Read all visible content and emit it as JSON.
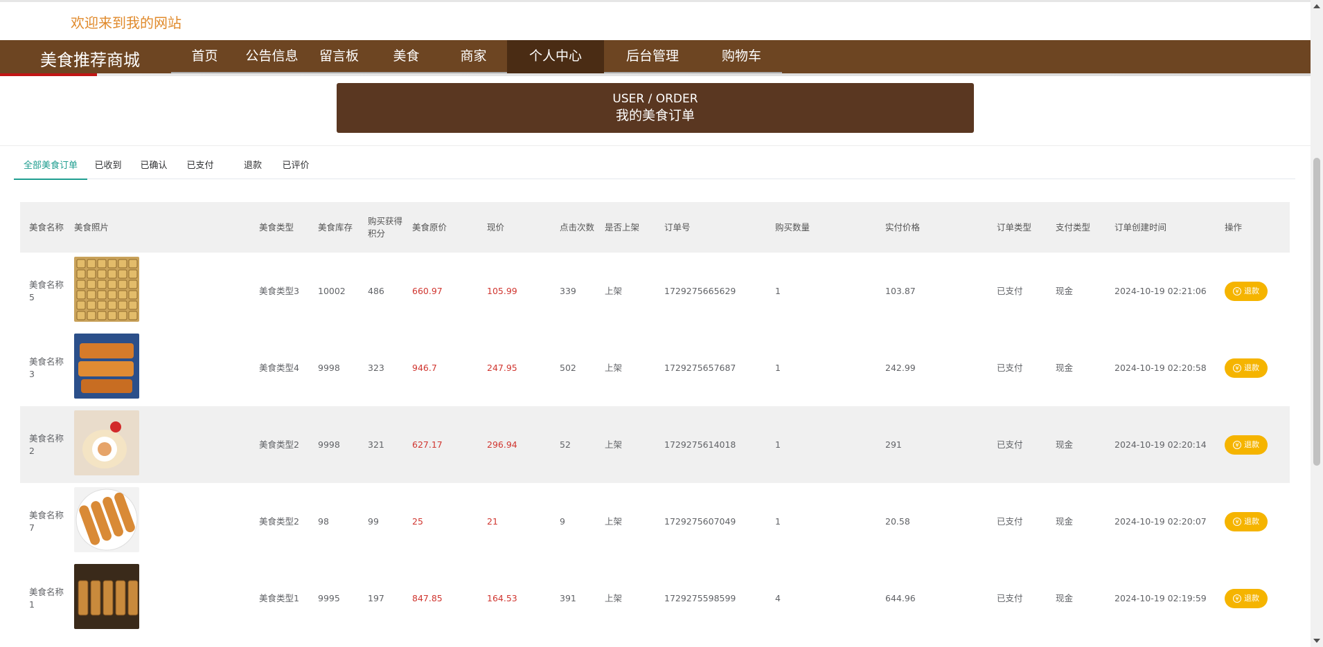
{
  "header": {
    "welcome": "欢迎来到我的网站"
  },
  "nav": {
    "brand": "美食推荐商城",
    "items": [
      {
        "label": "首页",
        "active": false
      },
      {
        "label": "公告信息",
        "active": false
      },
      {
        "label": "留言板",
        "active": false
      },
      {
        "label": "美食",
        "active": false
      },
      {
        "label": "商家",
        "active": false
      },
      {
        "label": "个人中心",
        "active": true
      },
      {
        "label": "后台管理",
        "active": false
      },
      {
        "label": "购物车",
        "active": false
      }
    ]
  },
  "banner": {
    "en": "USER / ORDER",
    "zh": "我的美食订单"
  },
  "tabs": [
    {
      "label": "全部美食订单",
      "active": true
    },
    {
      "label": "已收到",
      "active": false
    },
    {
      "label": "已确认",
      "active": false
    },
    {
      "label": "已支付",
      "active": false
    },
    {
      "label": "退款",
      "active": false
    },
    {
      "label": "已评价",
      "active": false
    }
  ],
  "table": {
    "columns": [
      "美食名称",
      "美食照片",
      "美食类型",
      "美食库存",
      "购买获得积分",
      "美食原价",
      "现价",
      "点击次数",
      "是否上架",
      "订单号",
      "购买数量",
      "实付价格",
      "订单类型",
      "支付类型",
      "订单创建时间",
      "操作"
    ],
    "rows": [
      {
        "name": "美食名称5",
        "photo": "fried-pastry-grid",
        "type": "美食类型3",
        "stock": "10002",
        "points": "486",
        "orig": "660.97",
        "price": "105.99",
        "clicks": "339",
        "shelf": "上架",
        "order_no": "1729275665629",
        "qty": "1",
        "paid": "103.87",
        "order_type": "已支付",
        "pay_type": "现金",
        "created": "2024-10-19 02:21:06",
        "action": "退款"
      },
      {
        "name": "美食名称3",
        "photo": "glazed-cake-bars",
        "type": "美食类型4",
        "stock": "9998",
        "points": "323",
        "orig": "946.7",
        "price": "247.95",
        "clicks": "502",
        "shelf": "上架",
        "order_no": "1729275657687",
        "qty": "1",
        "paid": "242.99",
        "order_type": "已支付",
        "pay_type": "现金",
        "created": "2024-10-19 02:20:58",
        "action": "退款"
      },
      {
        "name": "美食名称2",
        "photo": "swiss-roll",
        "type": "美食类型2",
        "stock": "9998",
        "points": "321",
        "orig": "627.17",
        "price": "296.94",
        "clicks": "52",
        "shelf": "上架",
        "order_no": "1729275614018",
        "qty": "1",
        "paid": "291",
        "order_type": "已支付",
        "pay_type": "现金",
        "created": "2024-10-19 02:20:14",
        "action": "退款"
      },
      {
        "name": "美食名称7",
        "photo": "hot-dog-rolls",
        "type": "美食类型2",
        "stock": "98",
        "points": "99",
        "orig": "25",
        "price": "21",
        "clicks": "9",
        "shelf": "上架",
        "order_no": "1729275607049",
        "qty": "1",
        "paid": "20.58",
        "order_type": "已支付",
        "pay_type": "现金",
        "created": "2024-10-19 02:20:07",
        "action": "退款"
      },
      {
        "name": "美食名称1",
        "photo": "grilled-skewers",
        "type": "美食类型1",
        "stock": "9995",
        "points": "197",
        "orig": "847.85",
        "price": "164.53",
        "clicks": "391",
        "shelf": "上架",
        "order_no": "1729275598599",
        "qty": "4",
        "paid": "644.96",
        "order_type": "已支付",
        "pay_type": "现金",
        "created": "2024-10-19 02:19:59",
        "action": "退款"
      }
    ]
  },
  "colors": {
    "nav_bg": "#6d4522",
    "nav_active": "#4a2c14",
    "banner_bg": "#5a3721",
    "welcome_text": "#e08a2c",
    "tab_active": "#1e9d8f",
    "price_red": "#d0352f",
    "refund_button": "#f5b400"
  }
}
